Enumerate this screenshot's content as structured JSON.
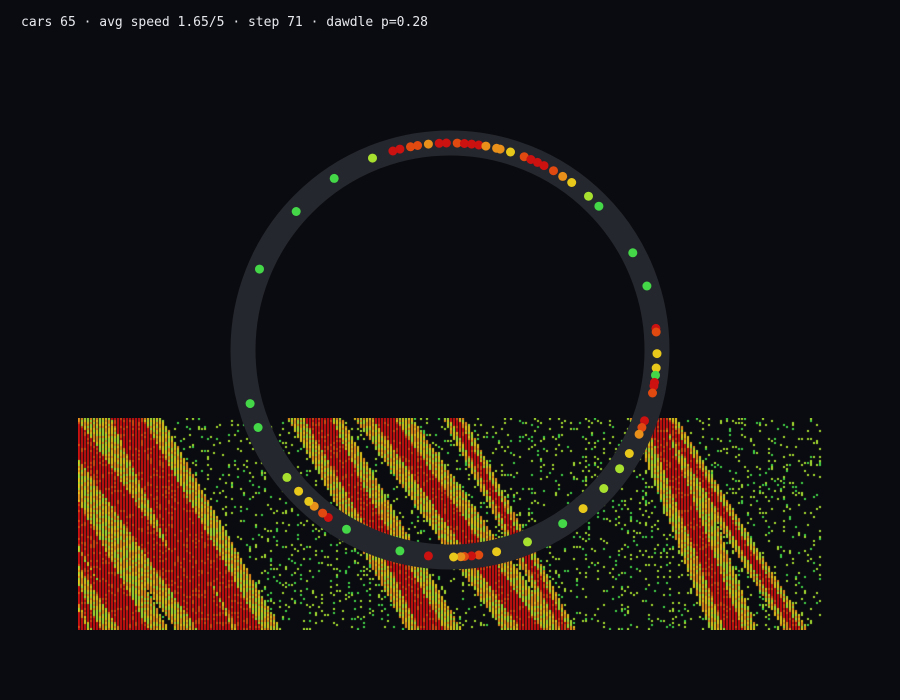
{
  "hud": {
    "status_text": "cars 65 · avg speed 1.65/5 · step 71 · dawdle p=0.28"
  },
  "simulation": {
    "cars": 65,
    "avg_speed": 1.65,
    "max_speed": 5,
    "step": 71,
    "dawdle_probability": 0.28
  },
  "colors": {
    "background": "#0a0b10",
    "road": "#25272e",
    "speed_0": "#cc1111",
    "speed_1": "#e04a10",
    "speed_2": "#e8901a",
    "speed_3": "#e8c81a",
    "speed_4": "#a8e030",
    "speed_5": "#44d848"
  }
}
